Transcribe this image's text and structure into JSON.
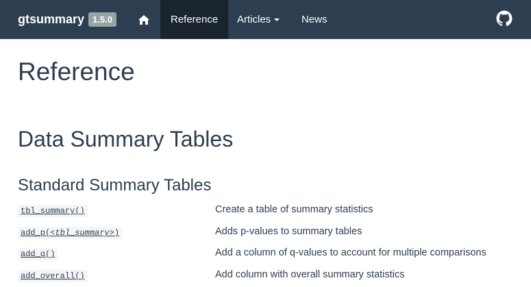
{
  "navbar": {
    "brand": "gtsummary",
    "version": "1.5.0",
    "home_icon": "home-icon",
    "items": [
      {
        "label": "Reference",
        "active": true
      },
      {
        "label": "Articles",
        "dropdown": true
      },
      {
        "label": "News"
      }
    ],
    "github_icon": "github-icon",
    "bg_color": "#2c3e50",
    "active_color": "#1a242f"
  },
  "main": {
    "page_title": "Reference",
    "section_title": "Data Summary Tables",
    "subsection_title": "Standard Summary Tables",
    "rows": [
      {
        "fn": "tbl_summary()",
        "arg": "",
        "suffix": "",
        "desc": "Create a table of summary statistics"
      },
      {
        "fn": "add_p(",
        "arg": "<tbl_summary>",
        "suffix": ")",
        "desc": "Adds p-values to summary tables"
      },
      {
        "fn": "add_q()",
        "arg": "",
        "suffix": "",
        "desc": "Add a column of q-values to account for multiple comparisons"
      },
      {
        "fn": "add_overall()",
        "arg": "",
        "suffix": "",
        "desc": "Add column with overall summary statistics"
      }
    ]
  }
}
